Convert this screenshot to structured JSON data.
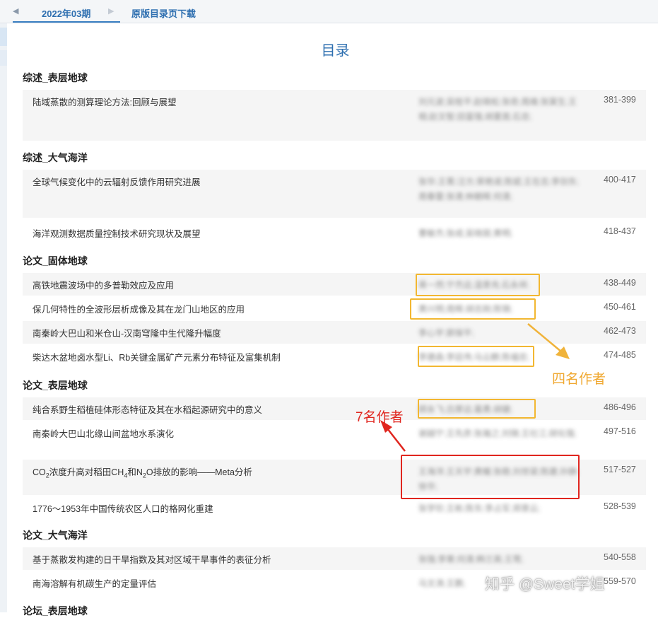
{
  "nav": {
    "issue_tab": "2022年03期",
    "download_tab": "原版目录页下载"
  },
  "toc_title": "目录",
  "sections": {
    "s1": "综述_表层地球",
    "s2": "综述_大气海洋",
    "s3": "论文_固体地球",
    "s4": "论文_表层地球",
    "s5": "论文_大气海洋",
    "s6": "论坛_表层地球"
  },
  "articles": {
    "a1": {
      "title": "陆域蒸散的测算理论方法:回顾与展望",
      "authors": "刘元波;吴桂平;赵晓松;张奇;周维;张寅生;王相;赵文智;田富强;胡夏嵩;石忠;",
      "pages": "381-399"
    },
    "a2": {
      "title": "全球气候变化中的云辐射反馈作用研究进展",
      "authors": "张华;王菁;汪方;荣艳淑;陈斌;王在志;李剑东;周春雷;张清;林朝晖;何清;",
      "pages": "400-417"
    },
    "a3": {
      "title": "海洋观测数据质量控制技术研究现状及展望",
      "authors": "曹敏杰;张成;吴晓丽;黄明;",
      "pages": "418-437"
    },
    "a4": {
      "title": "高铁地震波场中的多普勒效应及应用",
      "authors": "蒋一然;宁杰远;温景充;石永祥;",
      "pages": "438-449"
    },
    "a5": {
      "title": "保几何特性的全波形层析成像及其在龙门山地区的应用",
      "authors": "黄兴明;周辉;胡志刚;陈锦;",
      "pages": "450-461"
    },
    "a6": {
      "title": "南秦岭大巴山和米仓山-汉南穹隆中生代隆升幅度",
      "authors": "李心宇;郭保平;",
      "pages": "462-473"
    },
    "a7": {
      "title": "柴达木盆地卤水型Li、Rb关键金属矿产元素分布特征及富集机制",
      "authors": "李建森;李廷伟;马云麒;陈福忠;",
      "pages": "474-485"
    },
    "a8": {
      "title": "纯合系野生稻植硅体形态特征及其在水稻起源研究中的意义",
      "authors": "顾永飞;吕厚远;葛勇;胡健;",
      "pages": "486-496"
    },
    "a9": {
      "title": "南秦岭大巴山北缘山间盆地水系演化",
      "authors": "谢越宁;王先彦;张瀚之;刘锦;王社江;胡化强;",
      "pages": "497-516"
    },
    "a10": {
      "title_main": "CO",
      "title_sub1": "2",
      "title_mid1": "浓度升高对稻田CH",
      "title_sub2": "4",
      "title_mid2": "和N",
      "title_sub3": "2",
      "title_end": "O排放的影响——Meta分析",
      "authors": "王海洋;王天宇;黄耀;张稳;刘世梁;陈建;孙静;徐华;",
      "pages": "517-527"
    },
    "a11": {
      "title": "1776～1953年中国传统农区人口的格网化重建",
      "authors": "张学珍;王彬;陈东;李占军;郑景云;",
      "pages": "528-539"
    },
    "a12": {
      "title": "基于蒸散发构建的日干旱指数及其对区域干旱事件的表征分析",
      "authors": "张强;李栗;何清;韩兰英;王莺;",
      "pages": "540-558"
    },
    "a13": {
      "title": "南海溶解有机碳生产的定量评估",
      "authors": "马文涛;王鹏;",
      "pages": "559-570"
    }
  },
  "annotations": {
    "four_authors": "四名作者",
    "seven_authors": "7名作者"
  },
  "watermark": "知乎 @Sweet学姐",
  "colors": {
    "accent_blue": "#2e6fb0",
    "row_gray": "#f5f5f5",
    "highlight_orange": "#f2b731",
    "highlight_red": "#e0261f"
  }
}
